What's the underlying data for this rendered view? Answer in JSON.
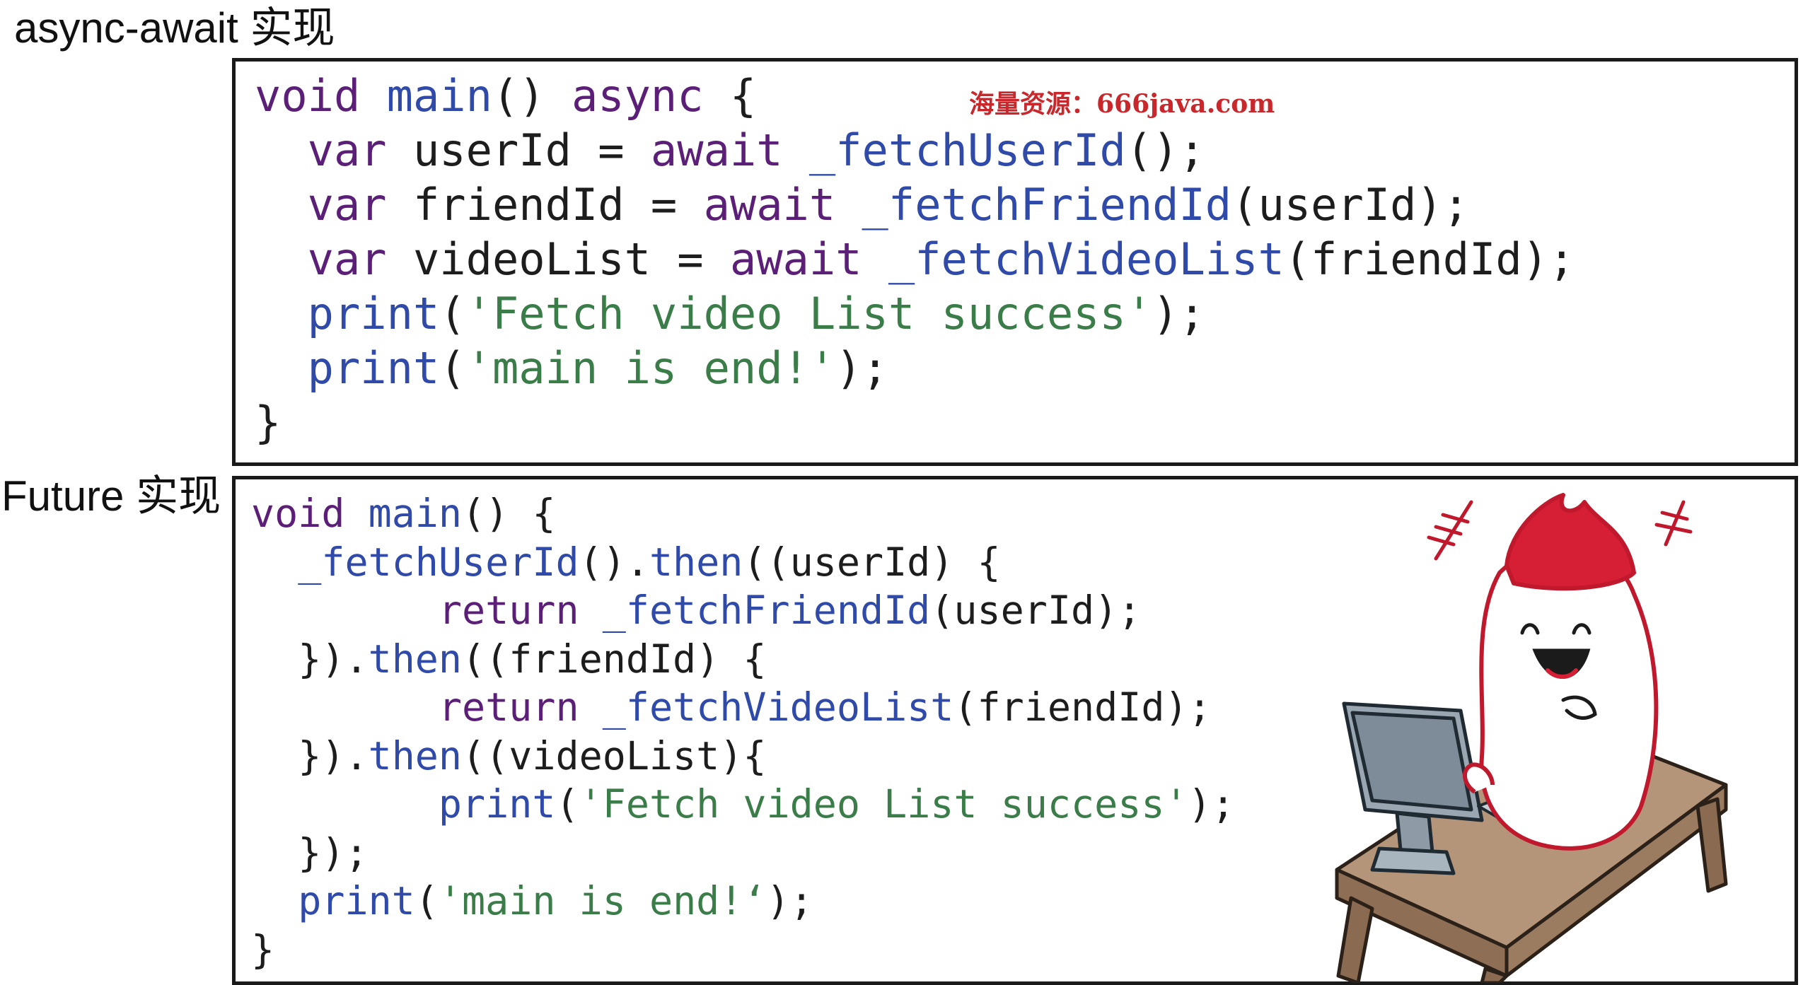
{
  "sections": {
    "async_label": "async-await 实现",
    "future_label": "Future 实现"
  },
  "watermark": "海量资源：666java.com",
  "async_code": {
    "l1": [
      "void ",
      "main",
      "() ",
      "async",
      " {"
    ],
    "l2": [
      "  ",
      "var",
      " userId = ",
      "await",
      " ",
      "_fetchUserId",
      "();"
    ],
    "l3": [
      "  ",
      "var",
      " friendId = ",
      "await",
      " ",
      "_fetchFriendId",
      "(userId);"
    ],
    "l4": [
      "  ",
      "var",
      " videoList = ",
      "await",
      " ",
      "_fetchVideoList",
      "(friendId);"
    ],
    "l5": [
      "  ",
      "print",
      "(",
      "'Fetch video List success'",
      ");"
    ],
    "l6": [
      "  ",
      "print",
      "(",
      "'main is end!'",
      ");"
    ],
    "l7": "}"
  },
  "future_code": {
    "l1": [
      "void ",
      "main",
      "() {"
    ],
    "l2": [
      "  ",
      "_fetchUserId",
      "().",
      "then",
      "((userId) {"
    ],
    "l3": [
      "        ",
      "return",
      " ",
      "_fetchFriendId",
      "(userId);"
    ],
    "l4": [
      "  }).",
      "then",
      "((friendId) {"
    ],
    "l5": [
      "        ",
      "return",
      " ",
      "_fetchVideoList",
      "(friendId);"
    ],
    "l6": [
      "  }).",
      "then",
      "((videoList){"
    ],
    "l7": [
      "        ",
      "print",
      "(",
      "'Fetch video List success'",
      ");"
    ],
    "l8": "  });",
    "l9": [
      "  ",
      "print",
      "(",
      "'main is end!‘",
      ");"
    ],
    "l10": "}"
  },
  "colors": {
    "keyword": "#5b1f78",
    "function": "#2f4aa8",
    "string": "#3a7d48",
    "watermark": "#c8282c",
    "mascot_red": "#d61f34"
  },
  "illustration": {
    "icon": "cartoon-mascot-at-computer-icon"
  }
}
